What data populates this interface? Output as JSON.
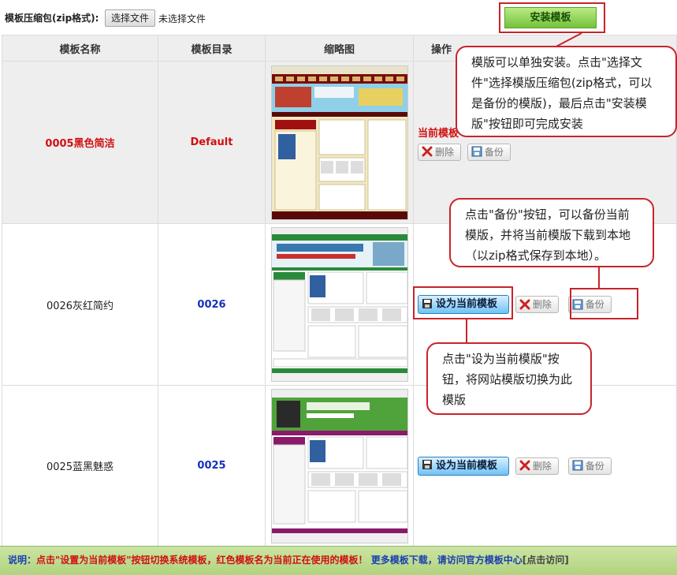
{
  "upload": {
    "label": "模板压缩包(zip格式):",
    "choose_file": "选择文件",
    "file_status": "未选择文件",
    "install_button": "安装模板"
  },
  "table": {
    "headers": [
      "模板名称",
      "模板目录",
      "缩略图",
      "操作"
    ],
    "rows": [
      {
        "name": "0005黑色简洁",
        "dir": "Default",
        "current": true,
        "current_label": "当前模板",
        "delete": "删除",
        "backup": "备份"
      },
      {
        "name": "0026灰红简约",
        "dir": "0026",
        "current": false,
        "set_label": "设为当前模板",
        "delete": "删除",
        "backup": "备份"
      },
      {
        "name": "0025蓝黑魅惑",
        "dir": "0025",
        "current": false,
        "set_label": "设为当前模板",
        "delete": "删除",
        "backup": "备份"
      }
    ]
  },
  "callouts": {
    "install": "模版可以单独安装。点击\"选择文件\"选择模版压缩包(zip格式，可以是备份的模版)，最后点击\"安装模版\"按钮即可完成安装",
    "backup": "点击\"备份\"按钮，可以备份当前模版，并将当前模版下载到本地（以zip格式保存到本地）。",
    "set": "点击\"设为当前模版\"按钮，将网站模版切换为此模版"
  },
  "footer": {
    "prefix": "说明：",
    "red_text": "点击\"设置为当前模板\"按钮切换系统模板，红色模板名为当前正在使用的模板！",
    "blue_text": "更多模板下载，请访问官方模板中心",
    "link": "[点击访问]"
  },
  "colors": {
    "accent_red": "#d01010",
    "install_green": "#74c23b",
    "set_blue": "#6fc2f4",
    "footer_green": "#b0d380",
    "callout_border": "#c8242a"
  },
  "icons": [
    "delete-icon",
    "backup-icon",
    "save-icon"
  ]
}
